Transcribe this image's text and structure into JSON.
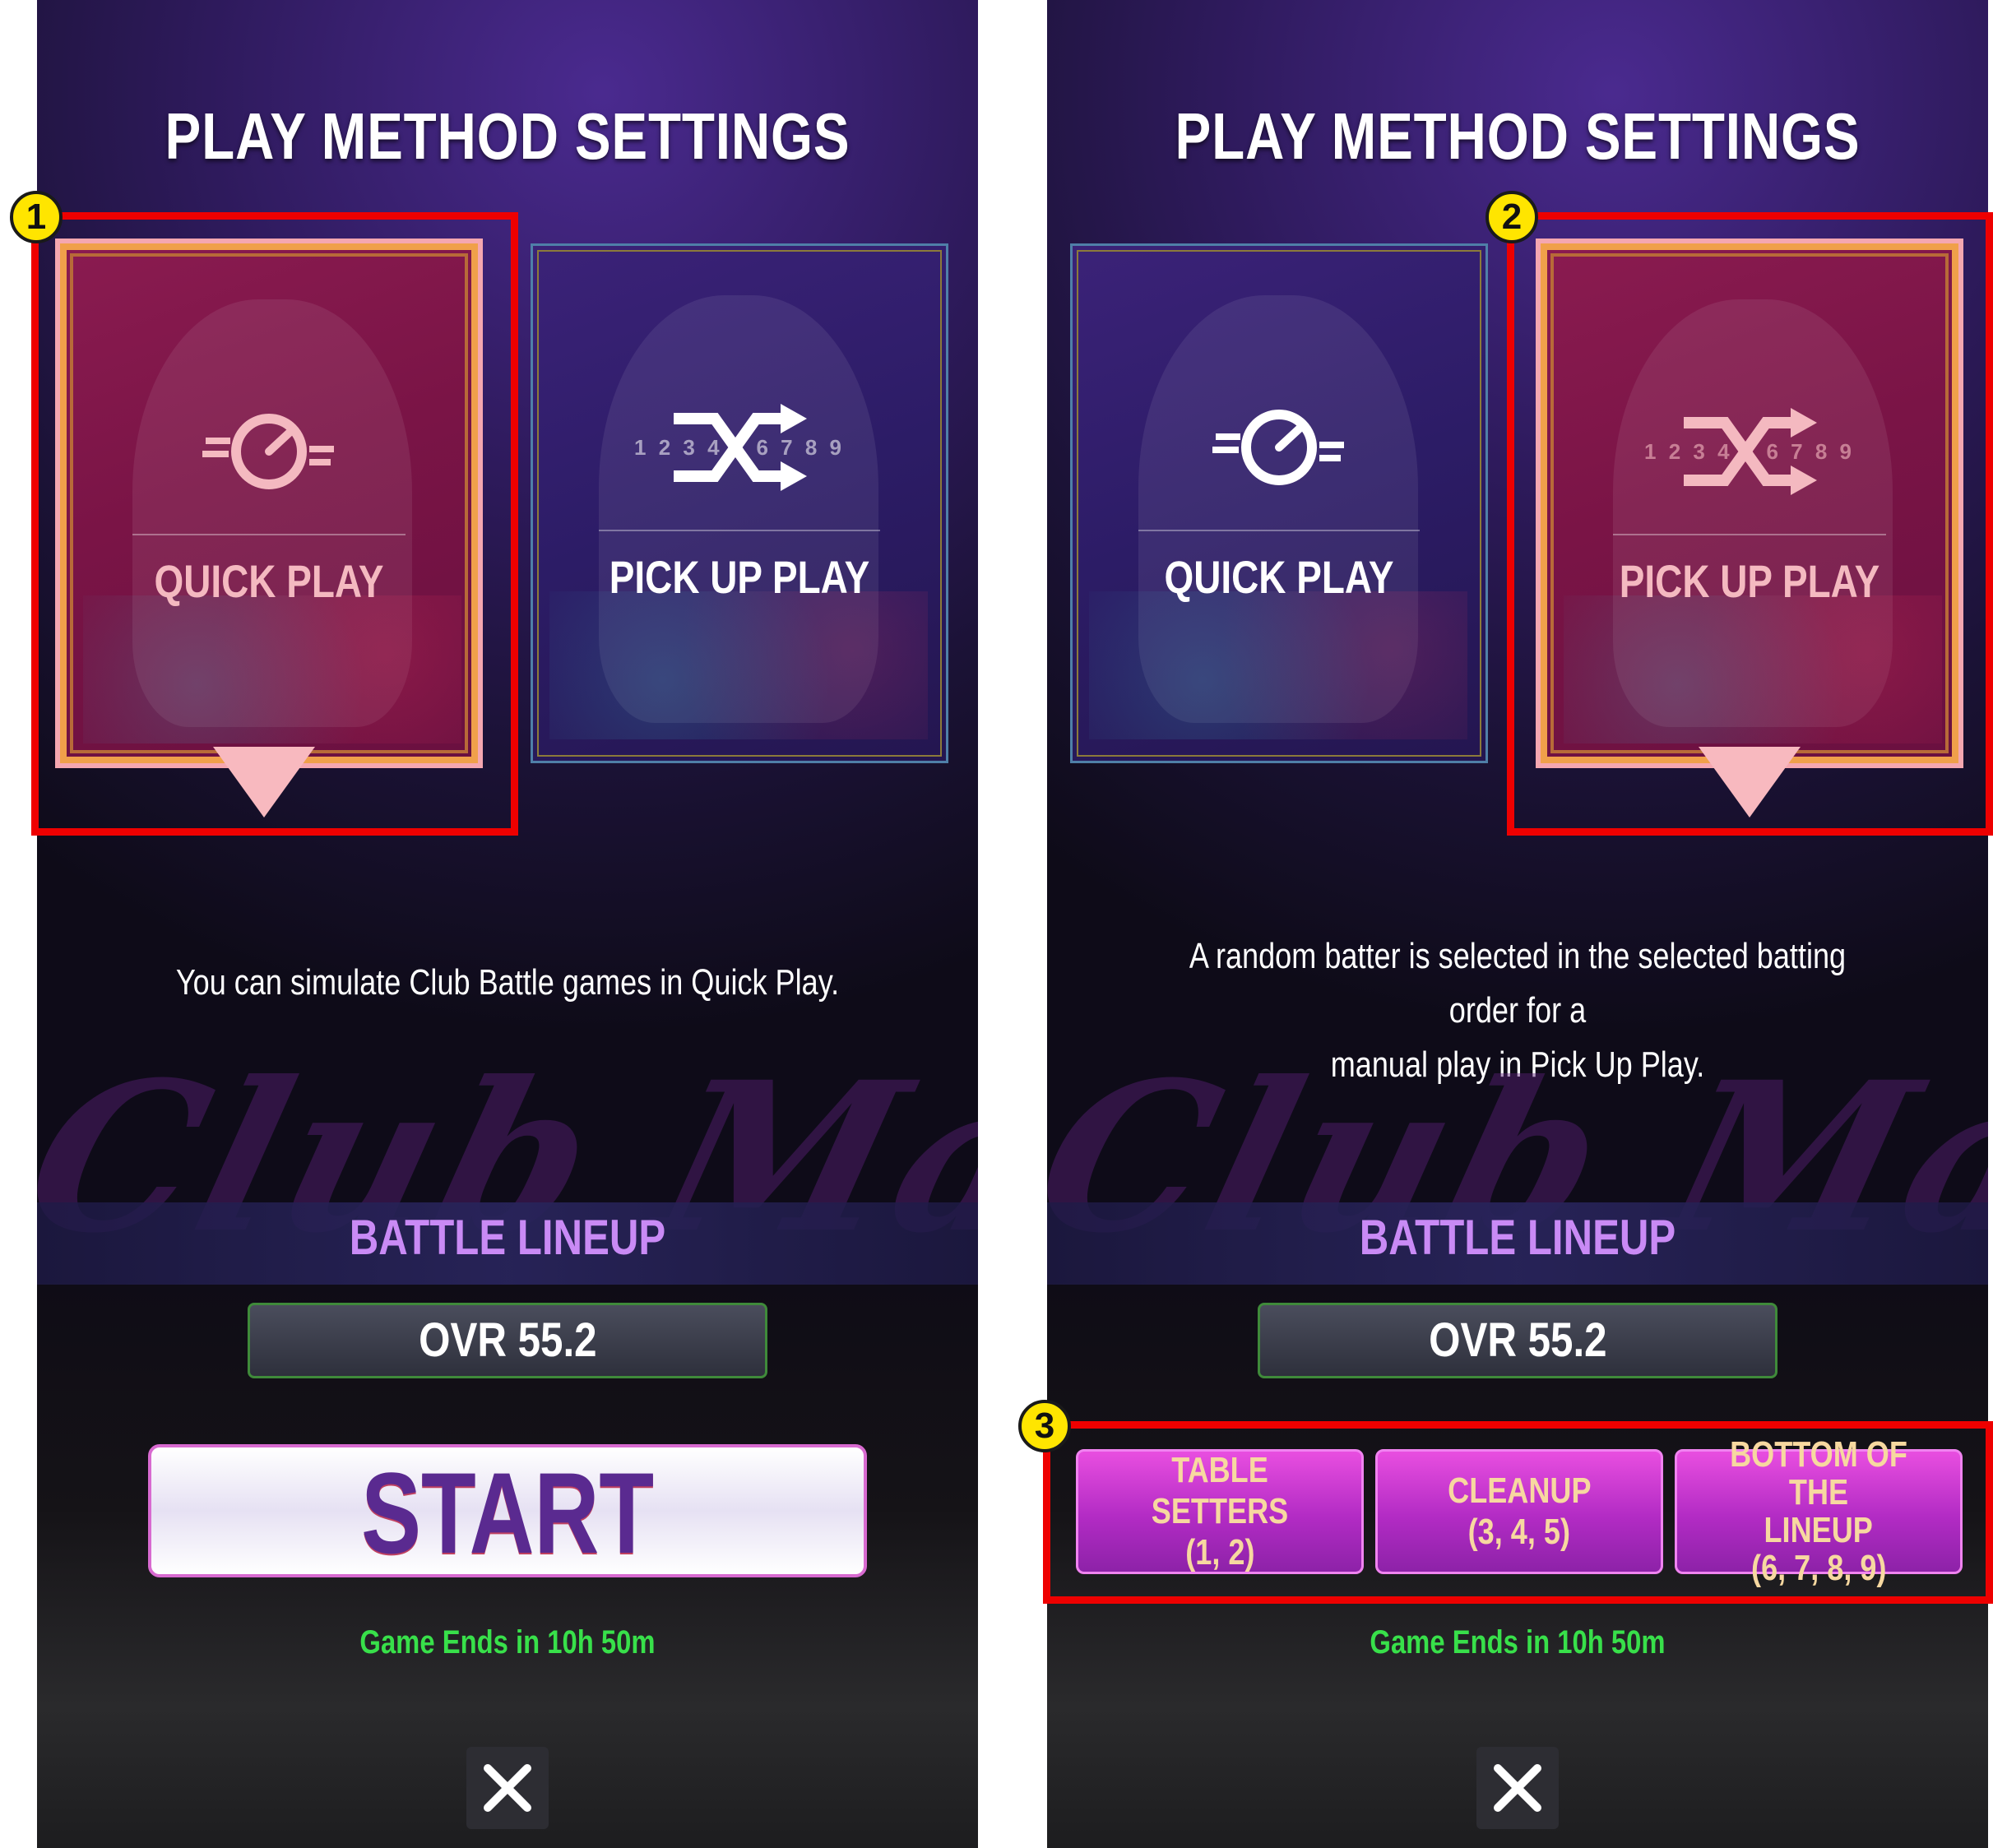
{
  "left_screen": {
    "title": "PLAY METHOD SETTINGS",
    "cards": [
      {
        "label": "QUICK PLAY",
        "icon": "speedometer-icon",
        "selected": true
      },
      {
        "label": "PICK UP PLAY",
        "icon": "shuffle-order-icon",
        "selected": false,
        "order_digits": "1 2 3 4 5 6 7 8 9"
      }
    ],
    "description": "You can simulate Club Battle games in Quick Play.",
    "lineup_title": "BATTLE LINEUP",
    "ovr": "OVR 55.2",
    "start_label": "START",
    "game_ends": "Game Ends in 10h 50m",
    "close_icon": "close-icon"
  },
  "right_screen": {
    "title": "PLAY METHOD SETTINGS",
    "cards": [
      {
        "label": "QUICK PLAY",
        "icon": "speedometer-icon",
        "selected": false
      },
      {
        "label": "PICK UP PLAY",
        "icon": "shuffle-order-icon",
        "selected": true,
        "order_digits": "1 2 3 4 5 6 7 8 9"
      }
    ],
    "description_line1": "A random batter is selected in the selected batting order for a",
    "description_line2": "manual play in Pick Up Play.",
    "lineup_title": "BATTLE LINEUP",
    "ovr": "OVR 55.2",
    "lineup_buttons": [
      {
        "line1": "TABLE SETTERS",
        "line2": "(1, 2)"
      },
      {
        "line1": "CLEANUP",
        "line2": "(3, 4, 5)"
      },
      {
        "line1": "BOTTOM OF THE",
        "line2": "LINEUP",
        "line3": "(6, 7, 8, 9)"
      }
    ],
    "game_ends": "Game Ends in 10h 50m",
    "close_icon": "close-icon"
  },
  "annotations": {
    "badge_1": "1",
    "badge_2": "2",
    "badge_3": "3",
    "highlight_color": "#ee0000",
    "badge_color": "#ffe500"
  },
  "watermark": "Club Match",
  "colors": {
    "selected_card": "#7a1446",
    "unselected_card": "#2c1c66",
    "lineup_title": "#c98af5",
    "game_ends": "#38e04a",
    "lineup_button": "#b22bc4"
  }
}
